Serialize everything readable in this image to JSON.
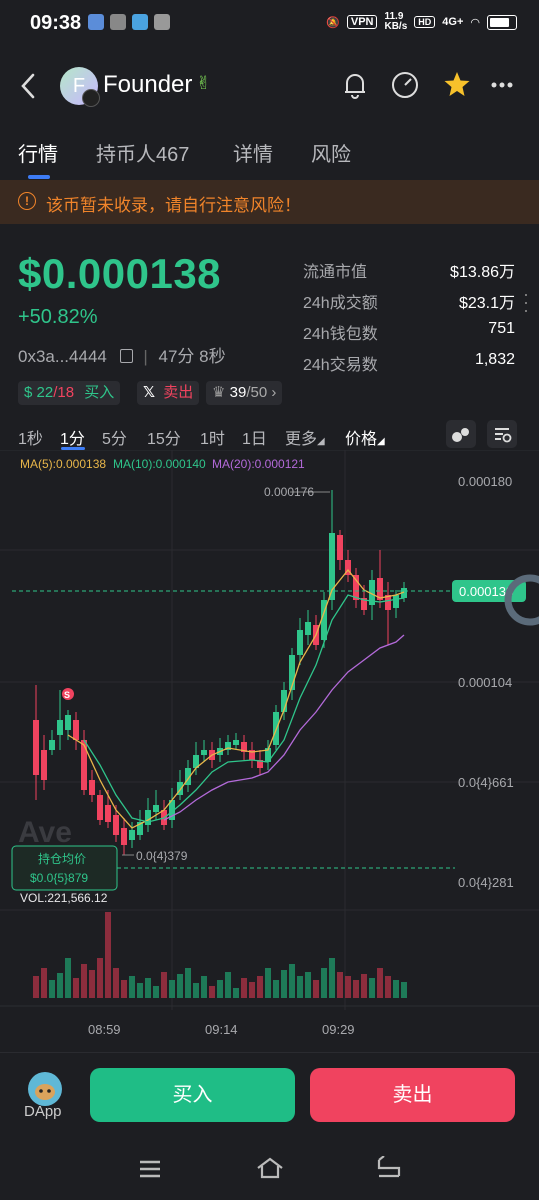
{
  "status": {
    "time": "09:38",
    "vpn": "VPN",
    "speed_top": "11.9",
    "speed_bottom": "KB/s",
    "hd": "HD",
    "net": "4G+"
  },
  "header": {
    "title": "Founder",
    "avatar_letter": "F"
  },
  "tabs": [
    "行情",
    "持币人467",
    "详情",
    "风险"
  ],
  "warning": "该币暂未收录，请自行注意风险！",
  "price": "$0.000138",
  "change": "+50.82%",
  "address": "0x3a...4444",
  "age": "47分 8秒",
  "stats": [
    {
      "label": "流通市值",
      "value": "$13.86万"
    },
    {
      "label": "24h成交额",
      "value": "$23.1万"
    },
    {
      "label": "24h钱包数",
      "value": "751"
    },
    {
      "label": "24h交易数",
      "value": "1,832"
    }
  ],
  "chips": {
    "holders": "22",
    "holders_total": "/18",
    "buy": "买入",
    "x_sell": "卖出",
    "rank": "39",
    "rank_total": "/50"
  },
  "intervals": [
    "1秒",
    "1分",
    "5分",
    "15分",
    "1时",
    "1日",
    "更多",
    "价格"
  ],
  "ma": {
    "ma5": "MA(5):0.000138",
    "ma10": "MA(10):0.000140",
    "ma20": "MA(20):0.000121"
  },
  "y_ticks": [
    "0.000180",
    "0.000104",
    "0.0{4}661",
    "0.0{4}281"
  ],
  "current_price_tag": "0.000138",
  "high_label": "0.000176",
  "low_label": "0.0{4}379",
  "hold_avg": {
    "label": "持仓均价",
    "value": "$0.0{5}879"
  },
  "sell_marker": "S",
  "volume": "VOL:221,566.12",
  "x_ticks": [
    "08:59",
    "09:14",
    "09:29"
  ],
  "watermark": "Ave",
  "colors": {
    "up": "#2fc58b",
    "down": "#f0435f",
    "accent": "#3d7cf5",
    "warn": "#f0842a",
    "ma5": "#e8b64a",
    "ma10": "#2fc58b",
    "ma20": "#b36ad9"
  },
  "bottom": {
    "dapp": "DApp",
    "buy": "买入",
    "sell": "卖出"
  }
}
